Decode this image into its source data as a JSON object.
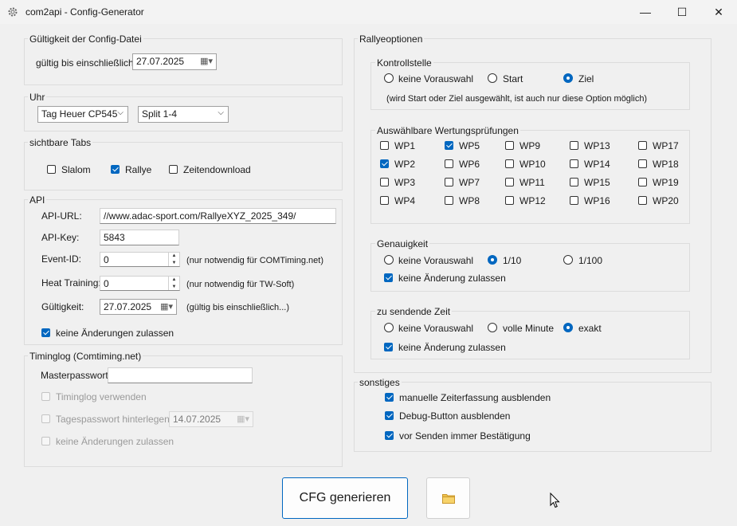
{
  "window": {
    "title": "com2api - Config-Generator",
    "minimize": "—",
    "maximize": "☐",
    "close": "✕",
    "app_icon": "gear-icon"
  },
  "validity": {
    "group": "Gültigkeit der Config-Datei",
    "label": "gültig bis einschließlich:",
    "date": "27.07.2025"
  },
  "clock": {
    "group": "Uhr",
    "model": "Tag Heuer CP545",
    "split": "Split 1-4"
  },
  "tabs": {
    "group": "sichtbare Tabs",
    "slalom": "Slalom",
    "rallye": "Rallye",
    "download": "Zeitendownload"
  },
  "api": {
    "group": "API",
    "url_label": "API-URL:",
    "url": "//www.adac-sport.com/RallyeXYZ_2025_349/",
    "key_label": "API-Key:",
    "key": "5843",
    "event_label": "Event-ID:",
    "event": "0",
    "event_hint": "(nur notwendig für COMTiming.net)",
    "heat_label": "Heat Training:",
    "heat": "0",
    "heat_hint": "(nur notwendig für TW-Soft)",
    "valid_label": "Gültigkeit:",
    "valid": "27.07.2025",
    "valid_hint": "(gültig bis einschließlich...)",
    "lock": "keine Änderungen zulassen"
  },
  "timinglog": {
    "group": "Timinglog (Comtiming.net)",
    "master_label": "Masterpasswort",
    "master": "",
    "use": "Timinglog verwenden",
    "daily": "Tagespasswort hinterlegen",
    "daily_date": "14.07.2025",
    "lock": "keine Änderungen zulassen"
  },
  "rally": {
    "group": "Rallyeoptionen",
    "control": {
      "group": "Kontrollstelle",
      "none": "keine Vorauswahl",
      "start": "Start",
      "finish": "Ziel",
      "note": "(wird Start oder Ziel ausgewählt, ist auch nur diese Option möglich)"
    },
    "wp_group": "Auswählbare Wertungsprüfungen",
    "wp": [
      "WP1",
      "WP5",
      "WP9",
      "WP13",
      "WP17",
      "WP2",
      "WP6",
      "WP10",
      "WP14",
      "WP18",
      "WP3",
      "WP7",
      "WP11",
      "WP15",
      "WP19",
      "WP4",
      "WP8",
      "WP12",
      "WP16",
      "WP20"
    ],
    "wp_checked": [
      "WP5",
      "WP2"
    ],
    "accuracy": {
      "group": "Genauigkeit",
      "none": "keine Vorauswahl",
      "tenth": "1/10",
      "hundredth": "1/100",
      "lock": "keine Änderung zulassen"
    },
    "sendtime": {
      "group": "zu sendende Zeit",
      "none": "keine Vorauswahl",
      "minute": "volle Minute",
      "exact": "exakt",
      "lock": "keine Änderung zulassen"
    }
  },
  "misc": {
    "group": "sonstiges",
    "hide_manual": "manuelle Zeiterfassung ausblenden",
    "hide_debug": "Debug-Button ausblenden",
    "confirm": "vor Senden immer Bestätigung"
  },
  "actions": {
    "generate": "CFG generieren",
    "folder_icon": "folder-icon"
  },
  "colors": {
    "accent": "#0067c0",
    "background": "#f0f0f0"
  }
}
